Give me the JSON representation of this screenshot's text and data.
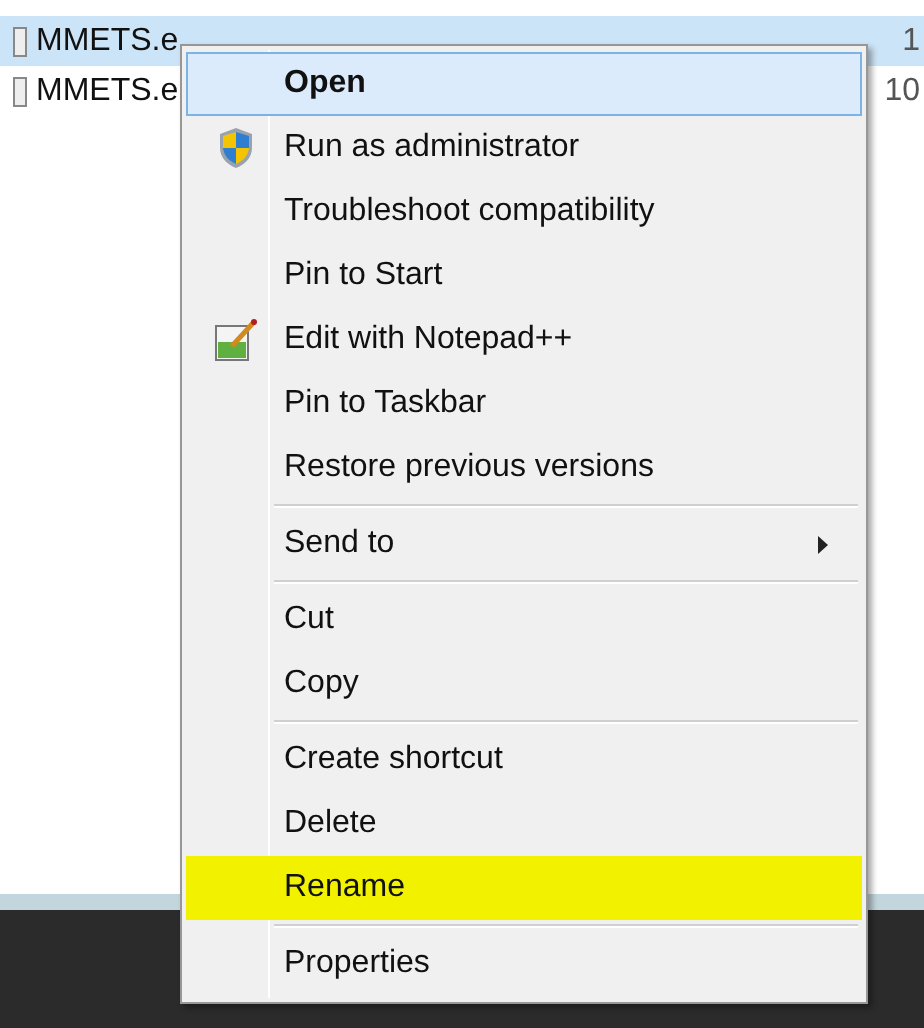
{
  "files": [
    {
      "name": "MMETS.e",
      "date": "1",
      "selected": true
    },
    {
      "name": "MMETS.e",
      "date": "10",
      "selected": false
    }
  ],
  "context_menu": {
    "groups": [
      {
        "items": [
          {
            "label": "Open",
            "selected": true,
            "highlighted": false
          },
          {
            "label": "Run as administrator",
            "kind": "shield",
            "selected": false,
            "highlighted": false
          },
          {
            "label": "Troubleshoot compatibility",
            "selected": false,
            "highlighted": false
          },
          {
            "label": "Pin to Start",
            "selected": false,
            "highlighted": false
          },
          {
            "label": "Edit with Notepad++",
            "kind": "notepad",
            "selected": false,
            "highlighted": false
          },
          {
            "label": "Pin to Taskbar",
            "selected": false,
            "highlighted": false
          },
          {
            "label": "Restore previous versions",
            "selected": false,
            "highlighted": false
          }
        ]
      },
      {
        "items": [
          {
            "label": "Send to",
            "submenu": true,
            "selected": false,
            "highlighted": false
          }
        ]
      },
      {
        "items": [
          {
            "label": "Cut",
            "selected": false,
            "highlighted": false
          },
          {
            "label": "Copy",
            "selected": false,
            "highlighted": false
          }
        ]
      },
      {
        "items": [
          {
            "label": "Create shortcut",
            "selected": false,
            "highlighted": false
          },
          {
            "label": "Delete",
            "selected": false,
            "highlighted": false
          },
          {
            "label": "Rename",
            "selected": false,
            "highlighted": true
          }
        ]
      },
      {
        "items": [
          {
            "label": "Properties",
            "selected": false,
            "highlighted": false
          }
        ]
      }
    ]
  }
}
